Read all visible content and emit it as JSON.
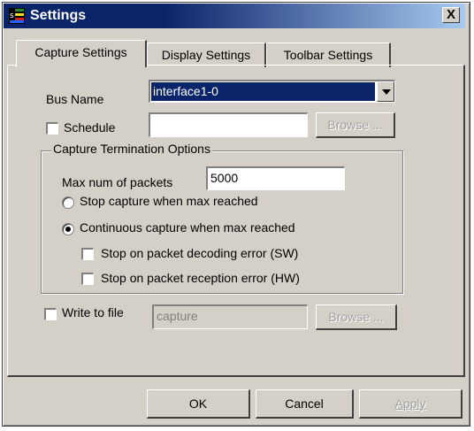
{
  "window": {
    "title": "Settings",
    "close_label": "X"
  },
  "tabs": [
    {
      "label": "Capture Settings",
      "active": true
    },
    {
      "label": "Display Settings",
      "active": false
    },
    {
      "label": "Toolbar Settings",
      "active": false
    }
  ],
  "bus": {
    "label": "Bus Name",
    "value": "interface1-0"
  },
  "schedule": {
    "label": "Schedule",
    "checked": false,
    "value": "",
    "browse_label": "Browse ..."
  },
  "termination": {
    "group_label": "Capture Termination Options",
    "max_packets_label": "Max num of packets",
    "max_packets_value": "5000",
    "stop_label": "Stop capture when max reached",
    "continuous_label": "Continuous capture when max reached",
    "selected": "continuous",
    "stop_decoding_label": "Stop on packet decoding error (SW)",
    "stop_reception_label": "Stop on packet reception error (HW)"
  },
  "write_to_file": {
    "label": "Write to file",
    "checked": false,
    "value": "capture",
    "browse_label": "Browse ..."
  },
  "buttons": {
    "ok": "OK",
    "cancel": "Cancel",
    "apply": "Apply"
  },
  "colors": {
    "title_bar": "#0a246a",
    "face": "#d4d0c8",
    "selection": "#0a246a"
  }
}
